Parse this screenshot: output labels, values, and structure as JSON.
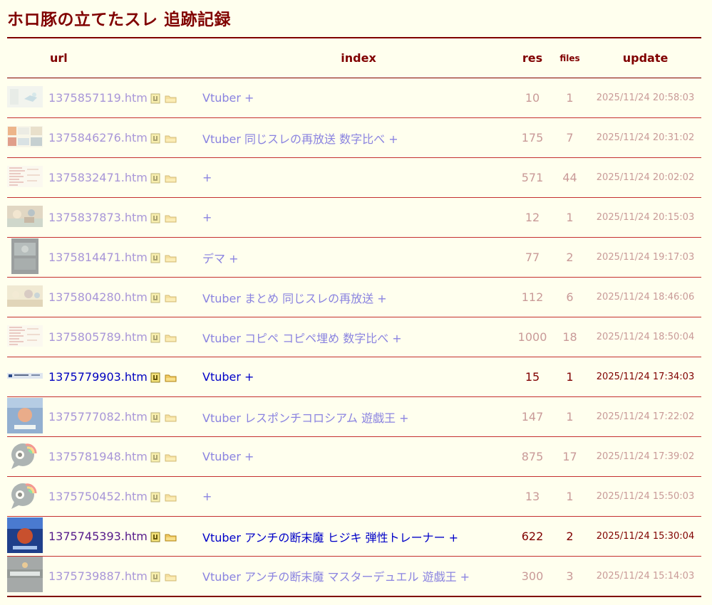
{
  "page_title": "ホロ豚の立てたスレ 追跡記録",
  "headers": {
    "url": "url",
    "index": "index",
    "res": "res",
    "files": "files",
    "update": "update"
  },
  "colors": {
    "accent": "#800000",
    "background": "#ffffee",
    "row_border": "#c43030"
  },
  "rows": [
    {
      "url": "1375857119.htm",
      "index": "Vtuber +",
      "res": "10",
      "files": "1",
      "update": "2025/11/24 20:58:03",
      "state": "faded",
      "thumb": "white-icons"
    },
    {
      "url": "1375846276.htm",
      "index": "Vtuber 同じスレの再放送 数字比べ +",
      "res": "175",
      "files": "7",
      "update": "2025/11/24 20:31:02",
      "state": "faded",
      "thumb": "collage"
    },
    {
      "url": "1375832471.htm",
      "index": "+",
      "res": "571",
      "files": "44",
      "update": "2025/11/24 20:02:02",
      "state": "faded",
      "thumb": "text-list"
    },
    {
      "url": "1375837873.htm",
      "index": "+",
      "res": "12",
      "files": "1",
      "update": "2025/11/24 20:15:03",
      "state": "faded",
      "thumb": "illustration"
    },
    {
      "url": "1375814471.htm",
      "index": "デマ +",
      "res": "77",
      "files": "2",
      "update": "2025/11/24 19:17:03",
      "state": "faded",
      "thumb": "dark-poster"
    },
    {
      "url": "1375804280.htm",
      "index": "Vtuber まとめ 同じスレの再放送 +",
      "res": "112",
      "files": "6",
      "update": "2025/11/24 18:46:06",
      "state": "faded",
      "thumb": "illustration-2"
    },
    {
      "url": "1375805789.htm",
      "index": "Vtuber コピペ コピペ埋め 数字比べ +",
      "res": "1000",
      "files": "18",
      "update": "2025/11/24 18:50:04",
      "state": "faded",
      "thumb": "text-list"
    },
    {
      "url": "1375779903.htm",
      "index": "Vtuber +",
      "res": "15",
      "files": "1",
      "update": "2025/11/24 17:34:03",
      "state": "strong",
      "thumb": "strip"
    },
    {
      "url": "1375777082.htm",
      "index": "Vtuber レスポンチコロシアム 遊戯王 +",
      "res": "147",
      "files": "1",
      "update": "2025/11/24 17:22:02",
      "state": "faded",
      "thumb": "blue-card"
    },
    {
      "url": "1375781948.htm",
      "index": "Vtuber +",
      "res": "875",
      "files": "17",
      "update": "2025/11/24 17:39:02",
      "state": "faded",
      "thumb": "speech-bubble"
    },
    {
      "url": "1375750452.htm",
      "index": "+",
      "res": "13",
      "files": "1",
      "update": "2025/11/24 15:50:03",
      "state": "faded",
      "thumb": "speech-bubble"
    },
    {
      "url": "1375745393.htm",
      "index": "Vtuber アンチの断末魔 ヒジキ 弾性トレーナー +",
      "res": "622",
      "files": "2",
      "update": "2025/11/24 15:30:04",
      "state": "strong-visited",
      "thumb": "blue-card-2"
    },
    {
      "url": "1375739887.htm",
      "index": "Vtuber アンチの断末魔 マスターデュエル 遊戯王 +",
      "res": "300",
      "files": "3",
      "update": "2025/11/24 15:14:03",
      "state": "faded",
      "thumb": "master-duel"
    }
  ]
}
